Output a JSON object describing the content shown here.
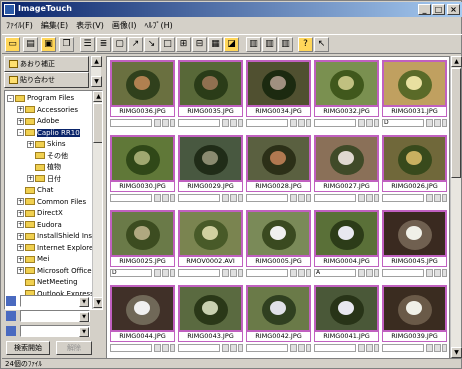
{
  "title": "ImageTouch",
  "window_controls": [
    "_",
    "□",
    "×"
  ],
  "menu": [
    "ﾌｧｲﾙ(F)",
    "編集(E)",
    "表示(V)",
    "画像(I)",
    "ﾍﾙﾌﾟ(H)"
  ],
  "left_buttons": {
    "correct": "あおり補正",
    "paste": "貼り合わせ"
  },
  "tree": [
    {
      "label": "Program Files",
      "indent": 0,
      "expand": "-"
    },
    {
      "label": "Accessories",
      "indent": 1,
      "expand": "+"
    },
    {
      "label": "Adobe",
      "indent": 1,
      "expand": "+"
    },
    {
      "label": "Caplio RR10",
      "indent": 1,
      "expand": "-",
      "selected": true
    },
    {
      "label": "Skins",
      "indent": 2,
      "expand": "+"
    },
    {
      "label": "その他",
      "indent": 2,
      "expand": ""
    },
    {
      "label": "植物",
      "indent": 2,
      "expand": ""
    },
    {
      "label": "日付",
      "indent": 2,
      "expand": "+"
    },
    {
      "label": "Chat",
      "indent": 1,
      "expand": ""
    },
    {
      "label": "Common Files",
      "indent": 1,
      "expand": "+"
    },
    {
      "label": "DirectX",
      "indent": 1,
      "expand": "+"
    },
    {
      "label": "Eudora",
      "indent": 1,
      "expand": "+"
    },
    {
      "label": "InstallShield Ins",
      "indent": 1,
      "expand": "+"
    },
    {
      "label": "Internet Explore",
      "indent": 1,
      "expand": "+"
    },
    {
      "label": "Mei",
      "indent": 1,
      "expand": "+"
    },
    {
      "label": "Microsoft Office",
      "indent": 1,
      "expand": "+"
    },
    {
      "label": "NetMeeting",
      "indent": 1,
      "expand": ""
    },
    {
      "label": "Outlook Express",
      "indent": 1,
      "expand": ""
    }
  ],
  "buttons": {
    "search": "検索開始",
    "cancel": "解除"
  },
  "thumbnails": [
    {
      "name": "RIMG0036.JPG",
      "info": "",
      "colors": [
        "#6a7040",
        "#30401c",
        "#b08050"
      ]
    },
    {
      "name": "RIMG0035.JPG",
      "info": "",
      "colors": [
        "#586838",
        "#2a3c18",
        "#907050"
      ]
    },
    {
      "name": "RIMG0034.JPG",
      "info": "",
      "colors": [
        "#505030",
        "#1c2a10",
        "#a09080"
      ]
    },
    {
      "name": "RIMG0032.JPG",
      "info": "",
      "colors": [
        "#7a9050",
        "#40581c",
        "#c0c080"
      ]
    },
    {
      "name": "RIMG0031.JPG",
      "info": "D",
      "colors": [
        "#c0a060",
        "#5a6a28",
        "#e8e0a0"
      ]
    },
    {
      "name": "RIMG0030.JPG",
      "info": "",
      "colors": [
        "#607838",
        "#304818",
        "#a0a870"
      ]
    },
    {
      "name": "RIMG0029.JPG",
      "info": "",
      "colors": [
        "#485840",
        "#202c18",
        "#8a8a70"
      ]
    },
    {
      "name": "RIMG0028.JPG",
      "info": "",
      "colors": [
        "#5a6040",
        "#2c3018",
        "#b07850"
      ]
    },
    {
      "name": "RIMG0027.JPG",
      "info": "",
      "colors": [
        "#8a7058",
        "#404a28",
        "#e0d8d0"
      ]
    },
    {
      "name": "RIMG0026.JPG",
      "info": "",
      "colors": [
        "#70683a",
        "#384a1c",
        "#c8b060"
      ]
    },
    {
      "name": "RIMG0025.JPG",
      "info": "D",
      "colors": [
        "#6a7a48",
        "#3c4c20",
        "#b0a880"
      ]
    },
    {
      "name": "RMOV0002.AVI",
      "info": "",
      "colors": [
        "#7a8450",
        "#485a28",
        "#d0d0a0"
      ]
    },
    {
      "name": "RIMG0005.JPG",
      "info": "",
      "colors": [
        "#7a8a58",
        "#3a4a20",
        "#f0f0f0"
      ]
    },
    {
      "name": "RIMG0004.JPG",
      "info": "A",
      "colors": [
        "#5a7038",
        "#2c3c18",
        "#e8e8f0"
      ]
    },
    {
      "name": "RIMG0045.JPG",
      "info": "",
      "colors": [
        "#3a2a20",
        "#706050",
        "#f0f0e8"
      ]
    },
    {
      "name": "RIMG0044.JPG",
      "info": "",
      "colors": [
        "#403028",
        "#706858",
        "#f0f0f0"
      ]
    },
    {
      "name": "RIMG0043.JPG",
      "info": "",
      "colors": [
        "#5a6a40",
        "#2a3818",
        "#c8d0b0"
      ]
    },
    {
      "name": "RIMG0042.JPG",
      "info": "",
      "colors": [
        "#6a7a48",
        "#304020",
        "#e0e0e8"
      ]
    },
    {
      "name": "RIMG0041.JPG",
      "info": "",
      "colors": [
        "#4a5838",
        "#283418",
        "#e8e8f0"
      ]
    },
    {
      "name": "RIMG0039.JPG",
      "info": "",
      "colors": [
        "#3a2c20",
        "#6a5a48",
        "#f0f0e8"
      ]
    }
  ],
  "status": "24個のﾌｧｲﾙ"
}
